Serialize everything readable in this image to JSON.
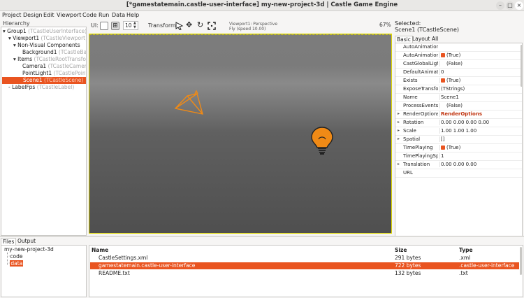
{
  "window": {
    "title": "[*gamestatemain.castle-user-interface] my-new-project-3d | Castle Game Engine",
    "min": "–",
    "max": "□",
    "close": "×"
  },
  "menu": [
    "Project",
    "Design",
    "Edit",
    "Viewport",
    "Code",
    "Run",
    "Data",
    "Help"
  ],
  "hierarchy": {
    "title": "Hierarchy",
    "nodes": [
      {
        "name": "Group1",
        "cls": "(TCastleUserInterface)"
      },
      {
        "name": "Viewport1",
        "cls": "(TCastleViewport)"
      },
      {
        "name": "Non-Visual Components",
        "cls": ""
      },
      {
        "name": "Background1",
        "cls": "(TCastleBackgr"
      },
      {
        "name": "Items",
        "cls": "(TCastleRootTransform)"
      },
      {
        "name": "Camera1",
        "cls": "(TCastleCamera)"
      },
      {
        "name": "PointLight1",
        "cls": "(TCastlePointL"
      },
      {
        "name": "Scene1",
        "cls": "(TCastleScene)"
      },
      {
        "name": "LabelFps",
        "cls": "(TCastleLabel)"
      }
    ]
  },
  "toolbar": {
    "ui_label": "UI:",
    "spin_value": "10",
    "transform_label": "Transform:",
    "viewport_line1": "Viewport1: Perspective",
    "viewport_line2": "Fly (speed 10.00)",
    "zoom": "67%"
  },
  "inspector": {
    "selected_label": "Selected:",
    "selected_value": "Scene1 (TCastleScene)",
    "tabs": [
      "Basic",
      "Layout",
      "All"
    ],
    "rows": [
      {
        "name": "AutoAnimation",
        "value": "",
        "check": "none",
        "expand": false,
        "red": false
      },
      {
        "name": "AutoAnimationLoop",
        "value": "(True)",
        "check": "on",
        "expand": false,
        "red": false
      },
      {
        "name": "CastGlobalLights",
        "value": "(False)",
        "check": "off",
        "expand": false,
        "red": false
      },
      {
        "name": "DefaultAnimationTransition",
        "value": "0",
        "check": "none",
        "expand": false,
        "red": false
      },
      {
        "name": "Exists",
        "value": "(True)",
        "check": "on",
        "expand": false,
        "red": false
      },
      {
        "name": "ExposeTransforms",
        "value": "(TStrings)",
        "check": "none",
        "expand": false,
        "red": false
      },
      {
        "name": "Name",
        "value": "Scene1",
        "check": "none",
        "expand": false,
        "red": false
      },
      {
        "name": "ProcessEvents",
        "value": "(False)",
        "check": "off",
        "expand": false,
        "red": false
      },
      {
        "name": "RenderOptions",
        "value": "RenderOptions",
        "check": "none",
        "expand": true,
        "red": true
      },
      {
        "name": "Rotation",
        "value": "0.00 0.00 0.00 0.00",
        "check": "none",
        "expand": true,
        "red": false
      },
      {
        "name": "Scale",
        "value": "1.00 1.00 1.00",
        "check": "none",
        "expand": true,
        "red": false
      },
      {
        "name": "Spatial",
        "value": "[]",
        "check": "none",
        "expand": true,
        "red": false
      },
      {
        "name": "TimePlaying",
        "value": "(True)",
        "check": "on",
        "expand": false,
        "red": false
      },
      {
        "name": "TimePlayingSpeed",
        "value": "1",
        "check": "none",
        "expand": false,
        "red": false
      },
      {
        "name": "Translation",
        "value": "0.00 0.00 0.00",
        "check": "none",
        "expand": true,
        "red": false
      },
      {
        "name": "URL",
        "value": "",
        "check": "none",
        "expand": false,
        "red": false
      }
    ]
  },
  "bottom": {
    "tabs": [
      "Files",
      "Output"
    ],
    "tree": [
      {
        "name": "my-new-project-3d"
      },
      {
        "name": "code"
      },
      {
        "name": "data"
      }
    ],
    "headers": {
      "name": "Name",
      "size": "Size",
      "type": "Type"
    },
    "files": [
      {
        "name": "CastleSettings.xml",
        "size": "291 bytes",
        "type": ".xml"
      },
      {
        "name": "gamestatemain.castle-user-interface",
        "size": "722 bytes",
        "type": ".castle-user-interface"
      },
      {
        "name": "README.txt",
        "size": "132 bytes",
        "type": ".txt"
      }
    ]
  },
  "colors": {
    "accent": "#e95420",
    "gizmo": "#f08a16"
  }
}
